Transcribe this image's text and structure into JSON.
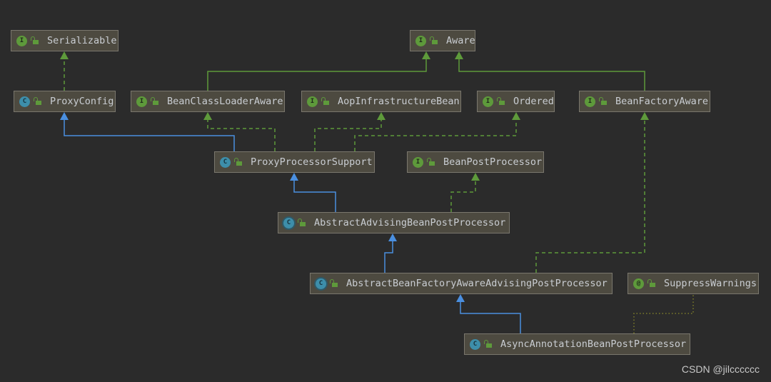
{
  "nodes": {
    "serializable": {
      "label": "Serializable",
      "kind": "interface"
    },
    "aware": {
      "label": "Aware",
      "kind": "interface"
    },
    "proxy_config": {
      "label": "ProxyConfig",
      "kind": "class"
    },
    "bean_class_loader_aware": {
      "label": "BeanClassLoaderAware",
      "kind": "interface"
    },
    "aop_infrastructure_bean": {
      "label": "AopInfrastructureBean",
      "kind": "interface"
    },
    "ordered": {
      "label": "Ordered",
      "kind": "interface"
    },
    "bean_factory_aware": {
      "label": "BeanFactoryAware",
      "kind": "interface"
    },
    "proxy_processor_support": {
      "label": "ProxyProcessorSupport",
      "kind": "class"
    },
    "bean_post_processor": {
      "label": "BeanPostProcessor",
      "kind": "interface"
    },
    "abstract_advising_bpp": {
      "label": "AbstractAdvisingBeanPostProcessor",
      "kind": "abstract-class"
    },
    "abstract_bf_aware_advising_pp": {
      "label": "AbstractBeanFactoryAwareAdvisingPostProcessor",
      "kind": "abstract-class"
    },
    "suppress_warnings": {
      "label": "SuppressWarnings",
      "kind": "annotation"
    },
    "async_annotation_bpp": {
      "label": "AsyncAnnotationBeanPostProcessor",
      "kind": "class"
    }
  },
  "badges": {
    "interface": "I",
    "class": "C",
    "abstract-class": "C",
    "annotation": "@"
  },
  "edges": [
    {
      "from": "proxy_config",
      "to": "serializable",
      "type": "implements"
    },
    {
      "from": "bean_class_loader_aware",
      "to": "aware",
      "type": "extends-interface"
    },
    {
      "from": "bean_factory_aware",
      "to": "aware",
      "type": "extends-interface"
    },
    {
      "from": "proxy_processor_support",
      "to": "proxy_config",
      "type": "extends"
    },
    {
      "from": "proxy_processor_support",
      "to": "bean_class_loader_aware",
      "type": "implements"
    },
    {
      "from": "proxy_processor_support",
      "to": "aop_infrastructure_bean",
      "type": "implements"
    },
    {
      "from": "proxy_processor_support",
      "to": "ordered",
      "type": "implements"
    },
    {
      "from": "abstract_advising_bpp",
      "to": "proxy_processor_support",
      "type": "extends"
    },
    {
      "from": "abstract_advising_bpp",
      "to": "bean_post_processor",
      "type": "implements"
    },
    {
      "from": "abstract_bf_aware_advising_pp",
      "to": "abstract_advising_bpp",
      "type": "extends"
    },
    {
      "from": "abstract_bf_aware_advising_pp",
      "to": "bean_factory_aware",
      "type": "implements"
    },
    {
      "from": "async_annotation_bpp",
      "to": "abstract_bf_aware_advising_pp",
      "type": "extends"
    },
    {
      "from": "async_annotation_bpp",
      "to": "suppress_warnings",
      "type": "annotated"
    }
  ],
  "colors": {
    "extends": "#4a8fe0",
    "implements": "#5e9a3b",
    "annotated": "#8a8a2a"
  },
  "watermark": "CSDN @jilcccccc"
}
